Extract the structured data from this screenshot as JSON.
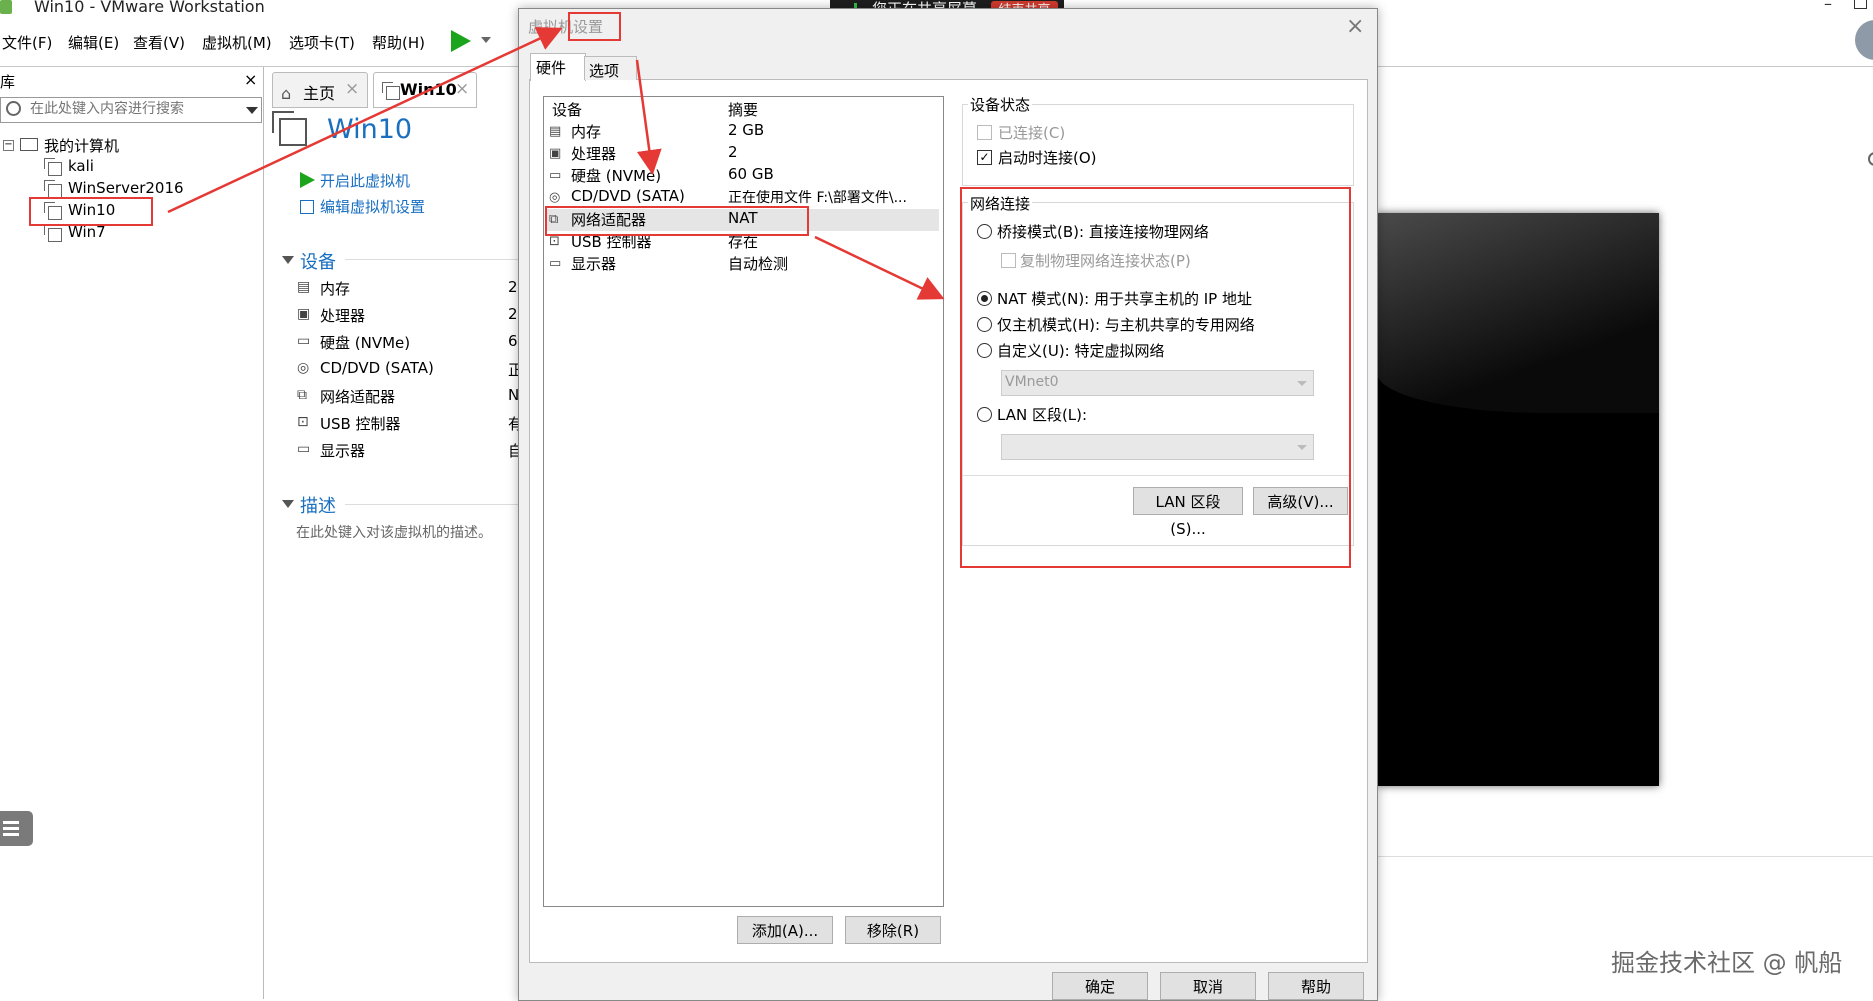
{
  "window": {
    "title": "Win10 - VMware Workstation",
    "minimize_glyph": "–"
  },
  "menu": [
    "文件(F)",
    "编辑(E)",
    "查看(V)",
    "虚拟机(M)",
    "选项卡(T)",
    "帮助(H)"
  ],
  "library": {
    "header_char": "库",
    "close_glyph": "×",
    "search_placeholder": "在此处键入内容进行搜索",
    "expander_glyph": "⊟",
    "root": "我的计算机",
    "vms": [
      "kali",
      "WinServer2016",
      "Win10",
      "Win7"
    ]
  },
  "tabs": {
    "home": "主页",
    "vm": "Win10",
    "close_glyph": "×",
    "home_icon": "⌂"
  },
  "vm_page": {
    "title": "Win10",
    "start_link": "开启此虚拟机",
    "edit_link": "编辑虚拟机设置",
    "devices_heading": "设备",
    "devices": [
      {
        "icon": "▤",
        "name": "内存",
        "cut": "2"
      },
      {
        "icon": "▣",
        "name": "处理器",
        "cut": "2"
      },
      {
        "icon": "▭",
        "name": "硬盘 (NVMe)",
        "cut": "6"
      },
      {
        "icon": "◎",
        "name": "CD/DVD (SATA)",
        "cut": "正"
      },
      {
        "icon": "⧉",
        "name": "网络适配器",
        "cut": "N"
      },
      {
        "icon": "⊡",
        "name": "USB 控制器",
        "cut": "有"
      },
      {
        "icon": "▭",
        "name": "显示器",
        "cut": "自"
      }
    ],
    "desc_heading": "描述",
    "desc_placeholder": "在此处键入对该虚拟机的描述。"
  },
  "sharing_bar": {
    "text": "您正在共享屏幕",
    "stop": "结束共享",
    "status_color": "#35c04a"
  },
  "dialog": {
    "title": "虚拟机设置",
    "close_glyph": "×",
    "tab_hardware": "硬件",
    "tab_options": "选项",
    "list_header_device": "设备",
    "list_header_summary": "摘要",
    "devices": [
      {
        "icon": "▤",
        "name": "内存",
        "summary": "2 GB"
      },
      {
        "icon": "▣",
        "name": "处理器",
        "summary": "2"
      },
      {
        "icon": "▭",
        "name": "硬盘 (NVMe)",
        "summary": "60 GB"
      },
      {
        "icon": "◎",
        "name": "CD/DVD (SATA)",
        "summary": "正在使用文件 F:\\部署文件\\..."
      },
      {
        "icon": "⧉",
        "name": "网络适配器",
        "summary": "NAT"
      },
      {
        "icon": "⊡",
        "name": "USB 控制器",
        "summary": "存在"
      },
      {
        "icon": "▭",
        "name": "显示器",
        "summary": "自动检测"
      }
    ],
    "selected_device": "网络适配器",
    "add_button": "添加(A)...",
    "remove_button": "移除(R)",
    "device_status": {
      "title": "设备状态",
      "connected": "已连接(C)",
      "connect_at_power_on": "启动时连接(O)",
      "check_glyph": "✓"
    },
    "network": {
      "title": "网络连接",
      "bridged": "桥接模式(B): 直接连接物理网络",
      "replicate": "复制物理网络连接状态(P)",
      "nat": "NAT 模式(N): 用于共享主机的 IP 地址",
      "host_only": "仅主机模式(H): 与主机共享的专用网络",
      "custom": "自定义(U): 特定虚拟网络",
      "custom_value": "VMnet0",
      "lan_segment": "LAN 区段(L):",
      "lan_segment_button": "LAN 区段(S)...",
      "advanced_button": "高级(V)...",
      "selected": "nat"
    },
    "ok_button": "确定",
    "cancel_button": "取消",
    "help_button": "帮助"
  },
  "watermark": "掘金技术社区 @ 帆船",
  "colors": {
    "annotation_red": "#e53935",
    "link_blue": "#1a6fc0",
    "play_green": "#1ca51c"
  }
}
